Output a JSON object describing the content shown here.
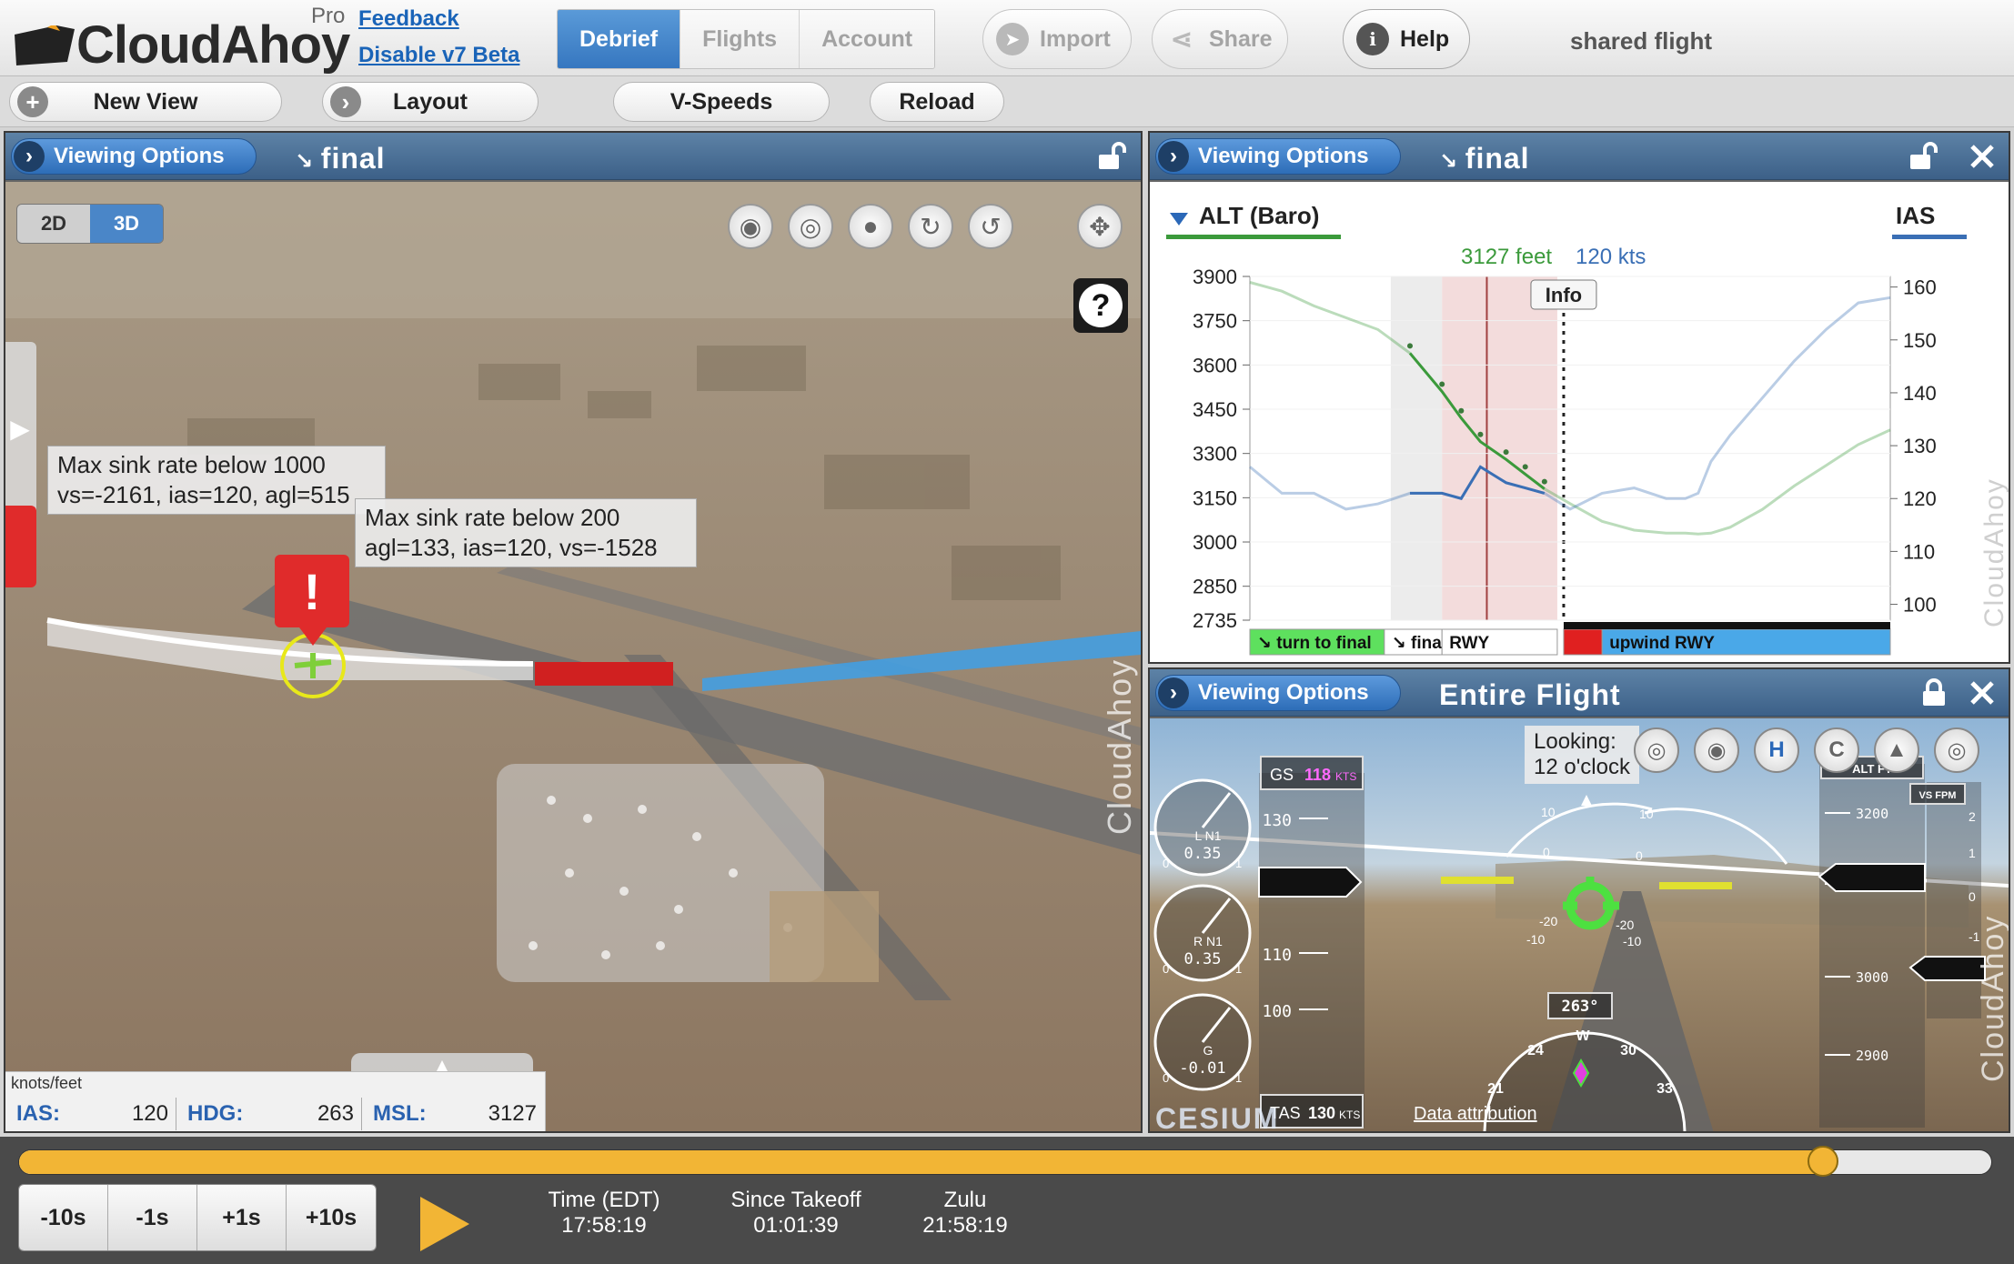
{
  "header": {
    "logo_text": "CloudAhoy",
    "pro_label": "Pro",
    "feedback_link": "Feedback",
    "beta_link": "Disable v7 Beta",
    "tabs": [
      {
        "label": "Debrief",
        "active": true
      },
      {
        "label": "Flights",
        "active": false
      },
      {
        "label": "Account",
        "active": false
      }
    ],
    "import_label": "Import",
    "share_label": "Share",
    "help_label": "Help",
    "shared_label": "shared flight"
  },
  "toolbar": {
    "new_view_label": "New View",
    "layout_label": "Layout",
    "vspeeds_label": "V-Speeds",
    "reload_label": "Reload"
  },
  "map_panel": {
    "viewing_options_label": "Viewing Options",
    "title": "final",
    "toggle": {
      "opt2d": "2D",
      "opt3d": "3D",
      "selected": "3D"
    },
    "callout1": {
      "line1": "Max sink rate below 1000",
      "line2": "vs=-2161, ias=120, agl=515"
    },
    "callout2": {
      "line1": "Max sink rate below 200",
      "line2": "agl=133, ias=120, vs=-1528"
    },
    "marker_symbol": "!",
    "help_symbol": "?",
    "watermark": "CloudAhoy",
    "readout": {
      "units": "knots/feet",
      "ias_label": "IAS:",
      "ias_value": "120",
      "hdg_label": "HDG:",
      "hdg_value": "263",
      "msl_label": "MSL:",
      "msl_value": "3127"
    }
  },
  "chart_panel": {
    "viewing_options_label": "Viewing Options",
    "title": "final",
    "watermark": "CloudAhoy",
    "info_label": "Info"
  },
  "chart_data": {
    "type": "line",
    "left_axis_label": "ALT (Baro)",
    "right_axis_label": "IAS",
    "readout_alt": "3127 feet",
    "readout_ias": "120 kts",
    "left_ticks": [
      "3900",
      "3750",
      "3600",
      "3450",
      "3300",
      "3150",
      "3000",
      "2850",
      "2735"
    ],
    "right_ticks": [
      "160",
      "150",
      "140",
      "130",
      "120",
      "110",
      "100"
    ],
    "left_range": [
      2735,
      3900
    ],
    "right_range": [
      97,
      162
    ],
    "series": [
      {
        "name": "ALT (Baro)",
        "color": "#3b9a3b",
        "x": [
          0,
          5,
          10,
          15,
          20,
          25,
          30,
          33,
          36,
          40,
          43,
          46,
          50,
          55,
          60,
          65,
          68,
          70,
          72,
          75,
          80,
          85,
          90,
          95,
          100
        ],
        "values": [
          3880,
          3850,
          3800,
          3760,
          3720,
          3640,
          3510,
          3420,
          3340,
          3280,
          3230,
          3180,
          3130,
          3070,
          3040,
          3030,
          3030,
          3027,
          3030,
          3050,
          3110,
          3190,
          3260,
          3330,
          3380
        ]
      },
      {
        "name": "IAS",
        "color": "#3a6fb5",
        "x": [
          0,
          5,
          10,
          15,
          20,
          25,
          30,
          33,
          36,
          40,
          43,
          46,
          50,
          55,
          60,
          65,
          68,
          70,
          72,
          75,
          80,
          85,
          90,
          95,
          100
        ],
        "values": [
          126,
          121,
          121,
          118,
          119,
          121,
          121,
          120,
          126,
          123,
          122,
          121,
          118,
          121,
          122,
          120,
          120,
          121,
          127,
          132,
          139,
          146,
          152,
          157,
          158
        ]
      }
    ],
    "segments": [
      {
        "label": "↘ turn to final",
        "color": "#5ee05e"
      },
      {
        "label": "↘ final",
        "color": "#ffffff"
      },
      {
        "label": "RWY",
        "color": "#ffffff"
      },
      {
        "label": "",
        "color": "#e02020"
      },
      {
        "label": "upwind RWY",
        "color": "#4aa8e8"
      }
    ]
  },
  "pfd_panel": {
    "viewing_options_label": "Viewing Options",
    "title": "Entire Flight",
    "looking_line1": "Looking:",
    "looking_line2": "12 o'clock",
    "watermark": "CloudAhoy",
    "data_attribution": "Data attribution",
    "cesium_logo": "CESIUM",
    "gauges": [
      {
        "label": "L N1",
        "value": "0.35",
        "min": "0",
        "max": "1"
      },
      {
        "label": "R N1",
        "value": "0.35",
        "min": "0",
        "max": "1"
      },
      {
        "label": "G",
        "value": "-0.01",
        "min": "0",
        "max": "1"
      }
    ],
    "gs_label": "GS",
    "gs_value": "118",
    "gs_unit": "KTS",
    "tas_label": "TAS",
    "tas_value": "130",
    "tas_unit": "KTS",
    "speed_ticks": [
      "130",
      "110",
      "100"
    ],
    "speed_current": "120",
    "alt_label": "ALT FT",
    "alt_ticks": [
      "3200",
      "3100",
      "3000",
      "2900"
    ],
    "alt_current": "3130",
    "vs_label": "VS FPM",
    "vs_ticks": [
      "2",
      "1",
      "0",
      "-1",
      "-2"
    ],
    "vs_current": "-1550",
    "heading": "263°",
    "pitch_ticks": [
      "10",
      "10",
      "0",
      "0",
      "-10",
      "-10",
      "-20",
      "-20"
    ],
    "compass_labels": [
      "21",
      "24",
      "W",
      "30",
      "33"
    ]
  },
  "bottom": {
    "timeline_progress": 0.915,
    "step_buttons": [
      "-10s",
      "-1s",
      "+1s",
      "+10s"
    ],
    "time_edt_label": "Time (EDT)",
    "time_edt_value": "17:58:19",
    "since_takeoff_label": "Since Takeoff",
    "since_takeoff_value": "01:01:39",
    "zulu_label": "Zulu",
    "zulu_value": "21:58:19"
  },
  "colors": {
    "accent_blue": "#3677c0",
    "panel_header": "#4a6d94",
    "timeline_orange": "#f2b535",
    "alt_green": "#3b9a3b",
    "ias_blue": "#3a6fb5",
    "alert_red": "#e02b2b"
  }
}
